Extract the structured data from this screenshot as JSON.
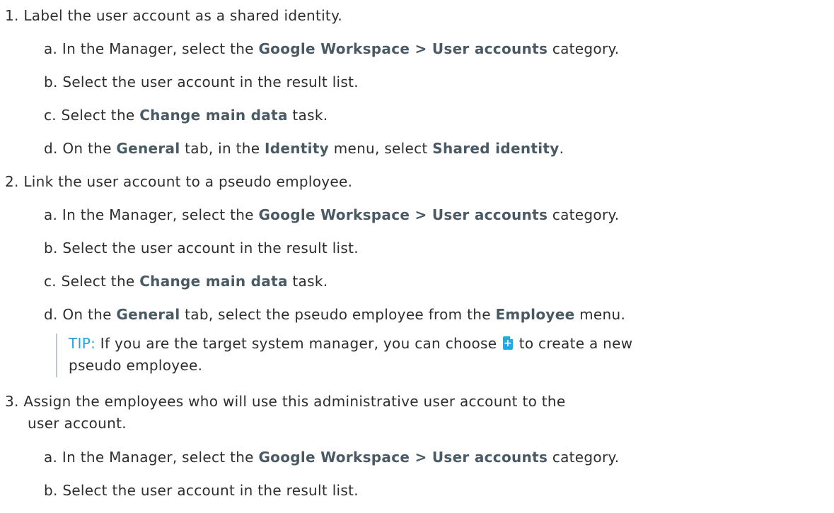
{
  "steps": [
    {
      "number": "1.",
      "text": "Label the user account as a shared identity.",
      "substeps": [
        {
          "letter": "a.",
          "pre": "In the Manager, select the ",
          "bold": "Google Workspace > User accounts",
          "post": " category."
        },
        {
          "letter": "b.",
          "text": "Select the user account in the result list."
        },
        {
          "letter": "c.",
          "pre": "Select the ",
          "bold": "Change main data",
          "post": " task."
        },
        {
          "letter": "d.",
          "pre": "On the ",
          "bold1": "General",
          "mid1": " tab, in the ",
          "bold2": "Identity",
          "mid2": " menu, select ",
          "bold3": "Shared identity",
          "post": "."
        }
      ]
    },
    {
      "number": "2.",
      "text": "Link the user account to a pseudo employee.",
      "substeps": [
        {
          "letter": "a.",
          "pre": "In the Manager, select the ",
          "bold": "Google Workspace > User accounts",
          "post": " category."
        },
        {
          "letter": "b.",
          "text": "Select the user account in the result list."
        },
        {
          "letter": "c.",
          "pre": "Select the ",
          "bold": "Change main data",
          "post": " task."
        },
        {
          "letter": "d.",
          "pre": "On the ",
          "bold1": "General",
          "mid1": " tab, select the pseudo employee from the ",
          "bold2": "Employee",
          "post": " menu."
        }
      ],
      "tip": {
        "label": "TIP:",
        "before_icon": " If you are the target system manager, you can choose ",
        "after_icon": " to create a new",
        "line2": "pseudo employee.",
        "icon": "add-document-icon"
      }
    },
    {
      "number": "3.",
      "text_line1": "Assign the employees who will use this administrative user account to the",
      "text_line2": "user account.",
      "substeps": [
        {
          "letter": "a.",
          "pre": "In the Manager, select the ",
          "bold": "Google Workspace > User accounts",
          "post": " category."
        },
        {
          "letter": "b.",
          "text": "Select the user account in the result list."
        }
      ]
    }
  ]
}
